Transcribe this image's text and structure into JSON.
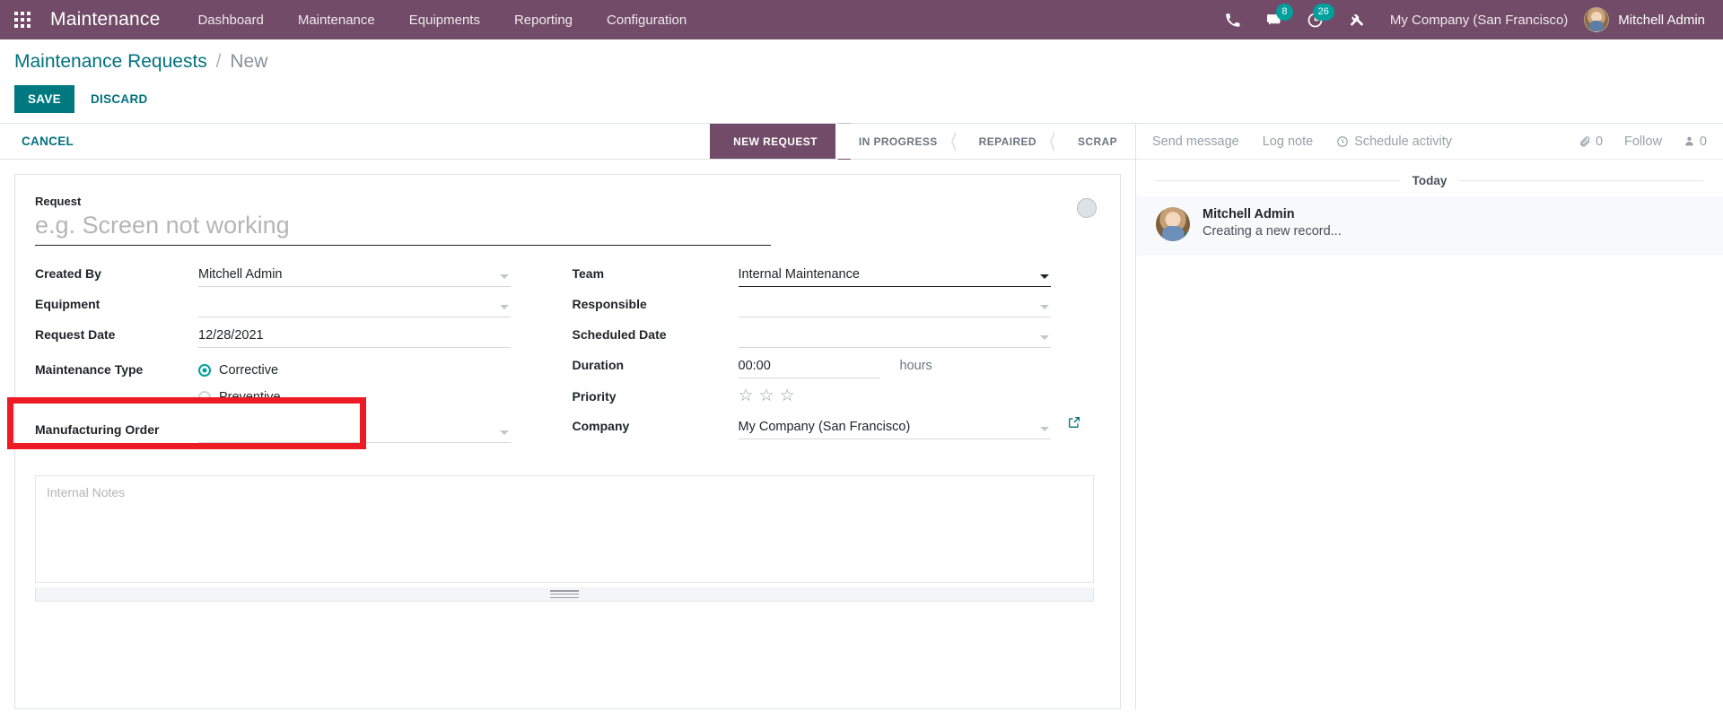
{
  "navbar": {
    "apps_icon": "apps-grid-icon",
    "brand": "Maintenance",
    "menus": [
      {
        "label": "Dashboard"
      },
      {
        "label": "Maintenance"
      },
      {
        "label": "Equipments"
      },
      {
        "label": "Reporting"
      },
      {
        "label": "Configuration"
      }
    ],
    "icons": {
      "phone": "phone-icon",
      "messages": "messages-icon",
      "activities": "activity-clock-icon",
      "tools": "tools-icon"
    },
    "messages_count": "8",
    "activities_count": "26",
    "company": "My Company (San Francisco)",
    "user": "Mitchell Admin"
  },
  "control_panel": {
    "breadcrumb_root": "Maintenance Requests",
    "breadcrumb_sep": "/",
    "breadcrumb_current": "New",
    "save_label": "SAVE",
    "discard_label": "DISCARD"
  },
  "statusbar": {
    "cancel_label": "CANCEL",
    "stages": [
      {
        "label": "NEW REQUEST",
        "active": true
      },
      {
        "label": "IN PROGRESS",
        "active": false
      },
      {
        "label": "REPAIRED",
        "active": false
      },
      {
        "label": "SCRAP",
        "active": false
      }
    ]
  },
  "form": {
    "request_label": "Request",
    "request_placeholder": "e.g. Screen not working",
    "request_value": "",
    "color_widget": "kanban-color-dot",
    "left": {
      "created_by_label": "Created By",
      "created_by_value": "Mitchell Admin",
      "equipment_label": "Equipment",
      "equipment_value": "",
      "request_date_label": "Request Date",
      "request_date_value": "12/28/2021",
      "maintenance_type_label": "Maintenance Type",
      "type_corrective": "Corrective",
      "type_preventive": "Preventive",
      "manufacturing_order_label": "Manufacturing Order",
      "manufacturing_order_value": ""
    },
    "right": {
      "team_label": "Team",
      "team_value": "Internal Maintenance",
      "responsible_label": "Responsible",
      "responsible_value": "",
      "scheduled_date_label": "Scheduled Date",
      "scheduled_date_value": "",
      "duration_label": "Duration",
      "duration_value": "00:00",
      "duration_unit": "hours",
      "priority_label": "Priority",
      "priority_stars": 3,
      "priority_filled": 0,
      "company_label": "Company",
      "company_value": "My Company (San Francisco)",
      "company_external_link": "external-link-icon"
    },
    "notes_placeholder": "Internal Notes",
    "notes_value": ""
  },
  "chatter": {
    "send_message": "Send message",
    "log_note": "Log note",
    "schedule_activity": "Schedule activity",
    "attachment_count": "0",
    "follow_label": "Follow",
    "follower_count": "0",
    "day_divider": "Today",
    "message_author": "Mitchell Admin",
    "message_body": "Creating a new record..."
  },
  "colors": {
    "navbar_purple": "#714B67",
    "accent_teal": "#00787F",
    "badge_teal": "#00A09D",
    "annotation_red": "#ED1C24"
  }
}
